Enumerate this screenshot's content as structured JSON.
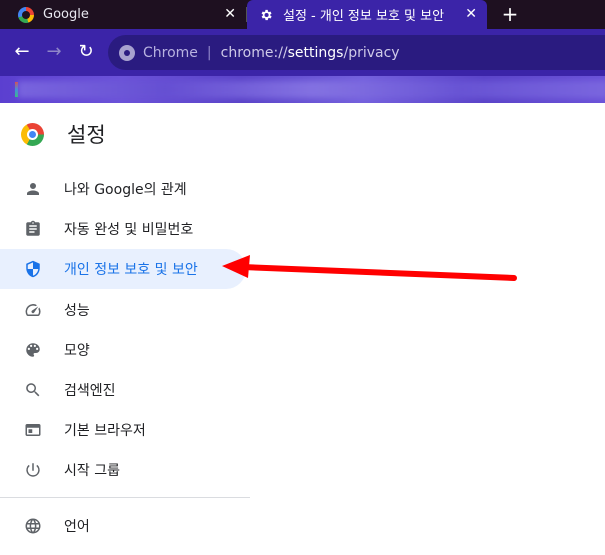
{
  "tabs": [
    {
      "title": "Google",
      "icon": "google-logo-icon",
      "active": false
    },
    {
      "title": "설정 - 개인 정보 보호 및 보안",
      "icon": "gear-icon",
      "active": true
    }
  ],
  "tab_close_glyph": "✕",
  "newtab_glyph": "+",
  "toolbar": {
    "back_glyph": "←",
    "forward_glyph": "→",
    "reload_glyph": "↻",
    "omnibox": {
      "scheme_label": "Chrome",
      "separator": "|",
      "url_prefix": "chrome://",
      "url_host": "settings",
      "url_path": "/privacy"
    }
  },
  "settings": {
    "title": "설정",
    "nav_items": [
      {
        "label": "나와 Google의 관계",
        "icon": "person-icon",
        "active": false
      },
      {
        "label": "자동 완성 및 비밀번호",
        "icon": "clipboard-icon",
        "active": false
      },
      {
        "label": "개인 정보 보호 및 보안",
        "icon": "shield-icon",
        "active": true
      },
      {
        "label": "성능",
        "icon": "speedometer-icon",
        "active": false
      },
      {
        "label": "모양",
        "icon": "palette-icon",
        "active": false
      },
      {
        "label": "검색엔진",
        "icon": "search-icon",
        "active": false
      },
      {
        "label": "기본 브라우저",
        "icon": "browser-window-icon",
        "active": false
      },
      {
        "label": "시작 그룹",
        "icon": "power-icon",
        "active": false
      },
      {
        "label": "언어",
        "icon": "globe-icon",
        "active": false
      }
    ]
  },
  "colors": {
    "accent": "#1a73e8",
    "active_bg": "#e8f0fe",
    "toolbar_bg": "#3b24a8",
    "annotation_arrow": "#ff0000"
  }
}
